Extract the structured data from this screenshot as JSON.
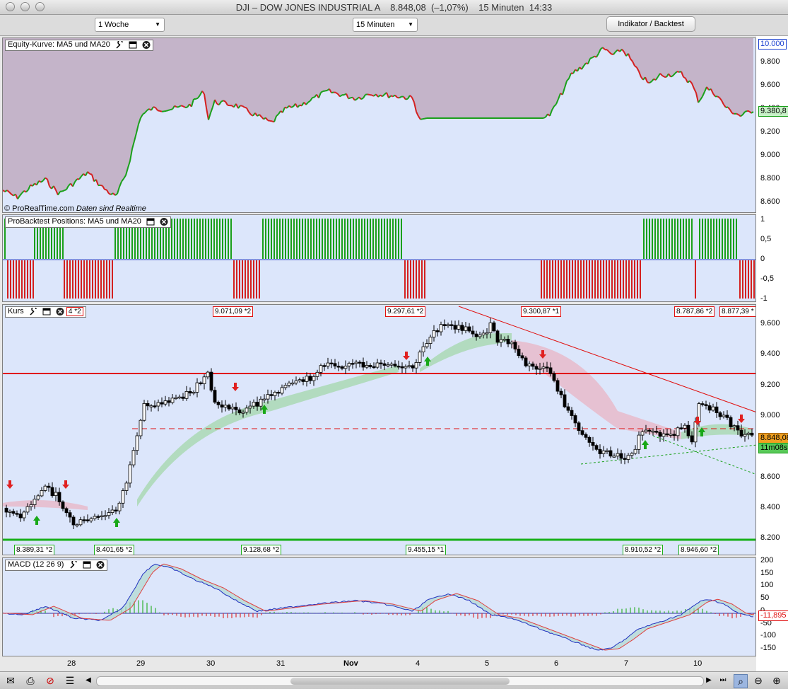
{
  "window": {
    "title": "DJI – DOW JONES INDUSTRIAL A    8.848,08  (–1,07%)    15 Minuten  14:33"
  },
  "toolbar": {
    "period": "1 Woche",
    "interval": "15 Minuten",
    "indicator_button": "Indikator / Backtest"
  },
  "equity_panel": {
    "label": "Equity-Kurve: MA5 und MA20",
    "copyright": "© ProRealTime.com",
    "realtime": "Daten sind Realtime",
    "ticks": [
      "10.000",
      "9.800",
      "9.600",
      "9.400",
      "9.200",
      "9.000",
      "8.800",
      "8.600"
    ],
    "current": "9.380,8"
  },
  "positions_panel": {
    "label": "ProBacktest Positions: MA5 und MA20",
    "ticks": [
      "1",
      "0,5",
      "0",
      "-0,5",
      "-1"
    ]
  },
  "price_panel": {
    "label": "Kurs",
    "top_left": "4 *2",
    "ticks": [
      "9.600",
      "9.400",
      "9.200",
      "9.000",
      "8.800",
      "8.600",
      "8.400",
      "8.200"
    ],
    "current_price": "8.848,08",
    "timer": "11m08s",
    "top_flags": [
      "9.071,09 *2",
      "9.297,61 *2",
      "9.300,87 *1",
      "8.787,86 *2",
      "8.877,39 *"
    ],
    "bottom_flags": [
      "8.389,31 *2",
      "8.401,65 *2",
      "9.128,68 *2",
      "9.455,15 *1",
      "8.910,52 *2",
      "8.946,60 *2"
    ]
  },
  "macd_panel": {
    "label": "MACD (12 26 9)",
    "ticks": [
      "200",
      "150",
      "100",
      "50",
      "0",
      "-50",
      "-100",
      "-150"
    ],
    "current": "-11,895"
  },
  "x_axis": [
    "28",
    "29",
    "30",
    "31",
    "Nov",
    "4",
    "5",
    "6",
    "7",
    "10"
  ],
  "colors": {
    "panel_bg": "#dce6fb",
    "green": "#1aa01a",
    "red": "#d42020",
    "equity_fill": "#c4b4c9"
  }
}
